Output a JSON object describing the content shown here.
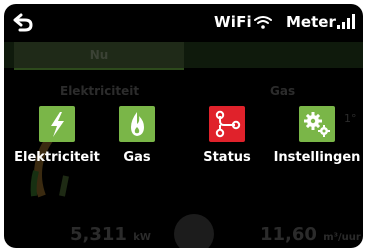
{
  "colors": {
    "screen_bg": "#000000",
    "green_tile": "#7ab648",
    "red_tile": "#e0222b",
    "text": "#ffffff"
  },
  "statusbar": {
    "back_icon": "back-arrow-icon",
    "wifi_label": "WiFi",
    "wifi_icon": "wifi-icon",
    "meter_label": "Meter",
    "signal_icon": "signal-bars-icon"
  },
  "background": {
    "tab_label": "Nu",
    "left_title": "Elektriciteit",
    "right_title": "Gas",
    "left_value": "5,311",
    "left_unit": "kW",
    "right_value": "11,60",
    "right_unit": "m³/uur",
    "gas_hint": "1°"
  },
  "menu": {
    "items": [
      {
        "label": "Elektriciteit",
        "icon": "lightning-icon",
        "color": "#7ab648"
      },
      {
        "label": "Gas",
        "icon": "flame-icon",
        "color": "#7ab648"
      },
      {
        "label": "Status",
        "icon": "network-nodes-icon",
        "color": "#e0222b"
      },
      {
        "label": "Instellingen",
        "icon": "gears-icon",
        "color": "#7ab648"
      }
    ]
  }
}
